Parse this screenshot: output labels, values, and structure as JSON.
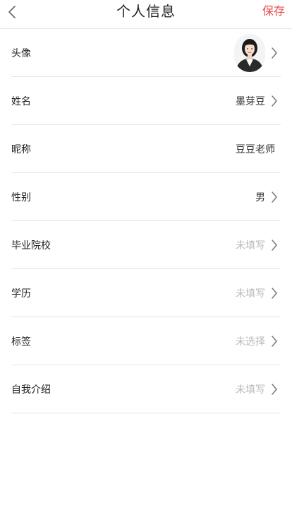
{
  "header": {
    "title": "个人信息",
    "save_label": "保存"
  },
  "rows": [
    {
      "label": "头像",
      "value": "",
      "placeholder": false,
      "has_chevron": true,
      "type": "avatar"
    },
    {
      "label": "姓名",
      "value": "墨芽豆",
      "placeholder": false,
      "has_chevron": true
    },
    {
      "label": "昵称",
      "value": "豆豆老师",
      "placeholder": false,
      "has_chevron": false
    },
    {
      "label": "性别",
      "value": "男",
      "placeholder": false,
      "has_chevron": true
    },
    {
      "label": "毕业院校",
      "value": "未填写",
      "placeholder": true,
      "has_chevron": true
    },
    {
      "label": "学历",
      "value": "未填写",
      "placeholder": true,
      "has_chevron": true
    },
    {
      "label": "标签",
      "value": "未选择",
      "placeholder": true,
      "has_chevron": true
    },
    {
      "label": "自我介绍",
      "value": "未填写",
      "placeholder": true,
      "has_chevron": true
    }
  ],
  "colors": {
    "accent": "#e84a4a",
    "placeholder_text": "#b8b8b8",
    "divider": "#e3e3e3"
  },
  "icons": {
    "back": "chevron-left-icon",
    "row_arrow": "chevron-right-icon"
  }
}
